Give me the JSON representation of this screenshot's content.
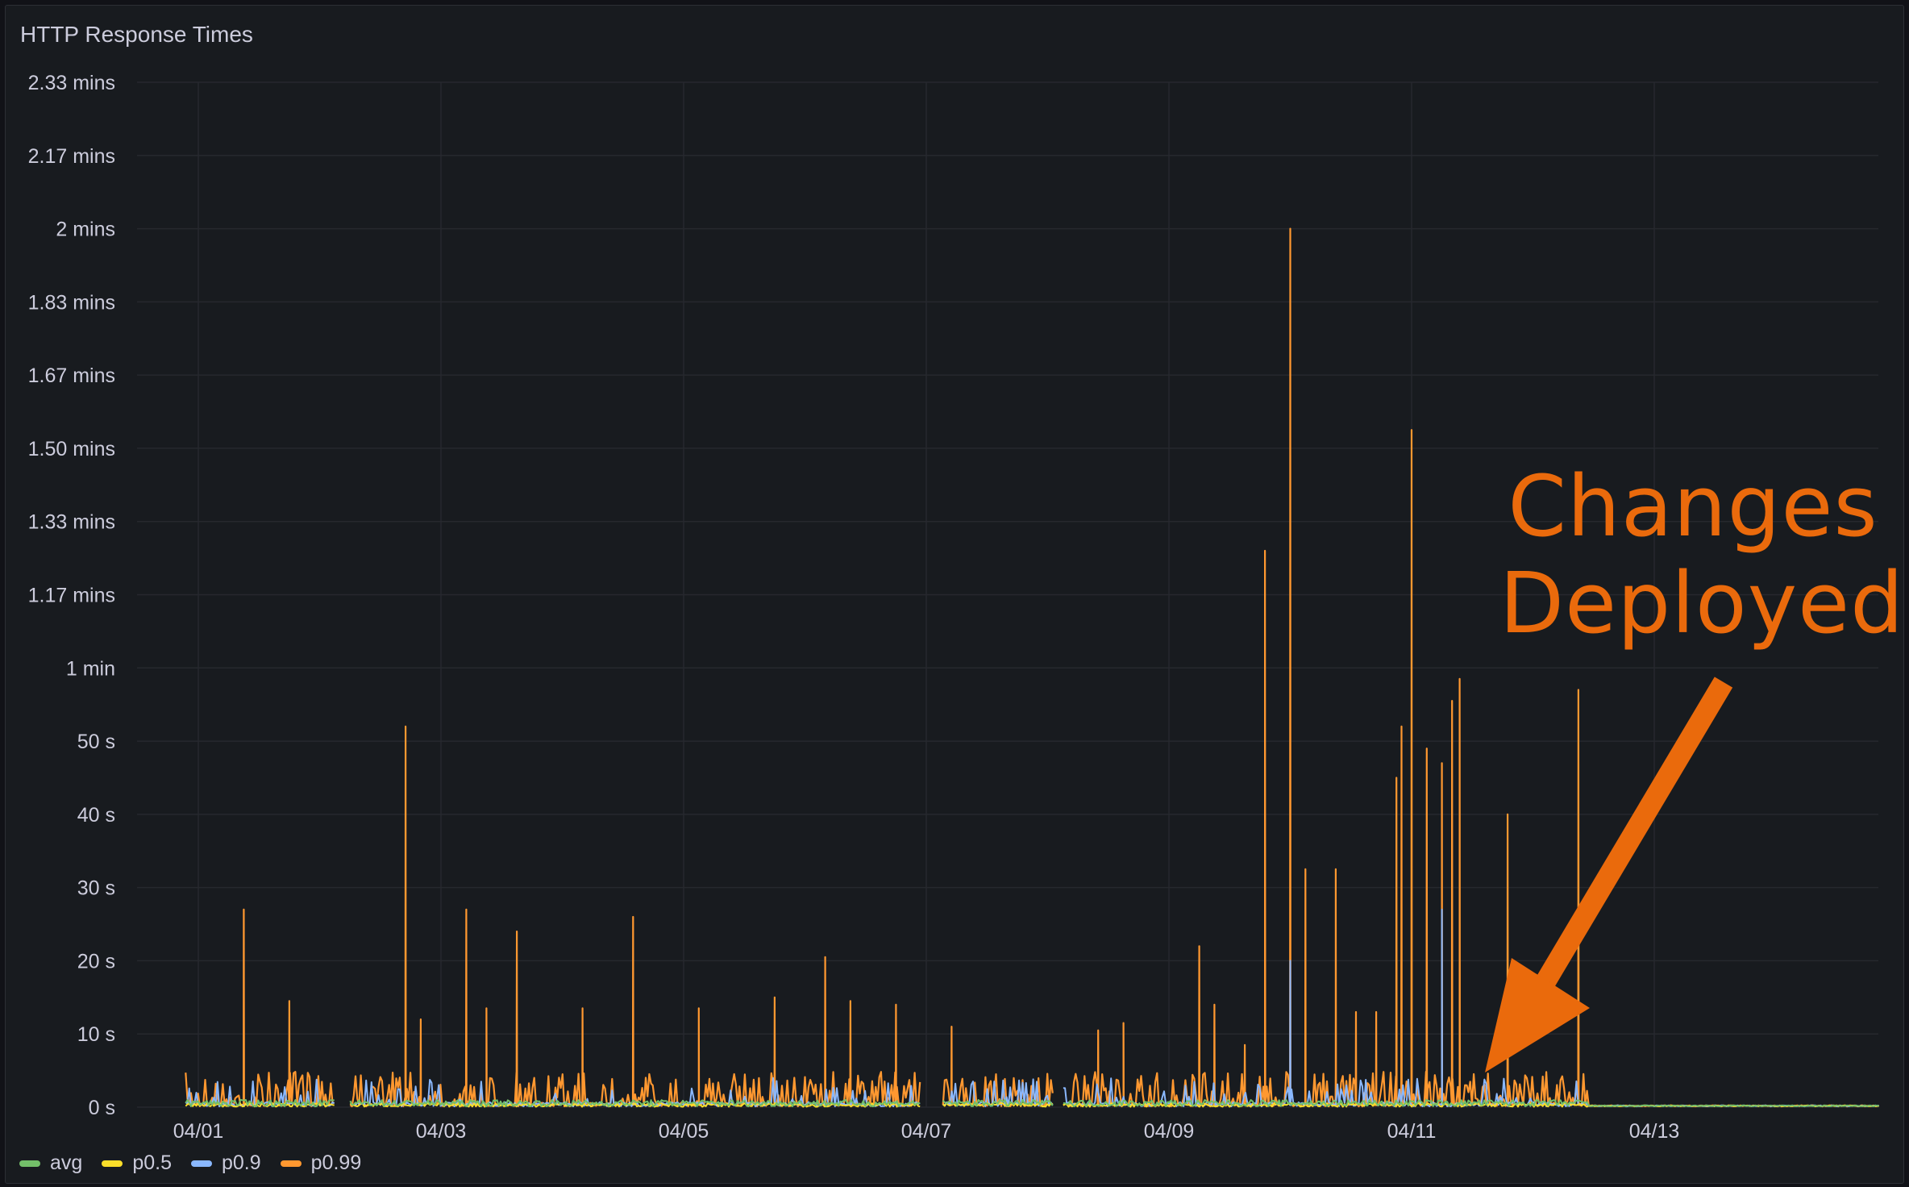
{
  "panel": {
    "title": "HTTP Response Times"
  },
  "annotation": {
    "line1": "Changes",
    "line2": "Deployed",
    "color": "#ea6a0c"
  },
  "legend": [
    {
      "label": "avg",
      "color": "#73bf69"
    },
    {
      "label": "p0.5",
      "color": "#fade2a"
    },
    {
      "label": "p0.9",
      "color": "#8ab8ff"
    },
    {
      "label": "p0.99",
      "color": "#ff9830"
    }
  ],
  "chart_data": {
    "type": "line",
    "title": "HTTP Response Times",
    "xlabel": "",
    "ylabel": "",
    "x_range": [
      "03/31 21:00",
      "04/14 21:00"
    ],
    "x_ticks": [
      "04/01",
      "04/03",
      "04/05",
      "04/07",
      "04/09",
      "04/11",
      "04/13"
    ],
    "ylim": [
      0,
      140
    ],
    "y_ticks": [
      {
        "value": 0,
        "label": "0 s"
      },
      {
        "value": 10,
        "label": "10 s"
      },
      {
        "value": 20,
        "label": "20 s"
      },
      {
        "value": 30,
        "label": "30 s"
      },
      {
        "value": 40,
        "label": "40 s"
      },
      {
        "value": 50,
        "label": "50 s"
      },
      {
        "value": 60,
        "label": "1 min"
      },
      {
        "value": 70,
        "label": "1.17 mins"
      },
      {
        "value": 80,
        "label": "1.33 mins"
      },
      {
        "value": 90,
        "label": "1.50 mins"
      },
      {
        "value": 100,
        "label": "1.67 mins"
      },
      {
        "value": 110,
        "label": "1.83 mins"
      },
      {
        "value": 120,
        "label": "2 mins"
      },
      {
        "value": 130,
        "label": "2.17 mins"
      },
      {
        "value": 140,
        "label": "2.33 mins"
      }
    ],
    "grid": true,
    "legend_position": "bottom-left",
    "series": [
      {
        "name": "p0.99",
        "color": "#ff9830",
        "spikes": [
          [
            "04/01 09:00",
            27
          ],
          [
            "04/01 18:00",
            14.5
          ],
          [
            "04/02 17:00",
            52
          ],
          [
            "04/02 20:00",
            12
          ],
          [
            "04/03 05:00",
            27
          ],
          [
            "04/03 09:00",
            13.5
          ],
          [
            "04/03 15:00",
            24
          ],
          [
            "04/04 04:00",
            13.5
          ],
          [
            "04/04 14:00",
            26
          ],
          [
            "04/05 03:00",
            13.5
          ],
          [
            "04/05 18:00",
            15
          ],
          [
            "04/06 04:00",
            20.5
          ],
          [
            "04/06 09:00",
            14.5
          ],
          [
            "04/06 18:00",
            14
          ],
          [
            "04/07 05:00",
            11
          ],
          [
            "04/08 10:00",
            10.5
          ],
          [
            "04/08 15:00",
            11.5
          ],
          [
            "04/09 06:00",
            22
          ],
          [
            "04/09 09:00",
            14
          ],
          [
            "04/09 15:00",
            8.5
          ],
          [
            "04/09 19:00",
            76
          ],
          [
            "04/10 00:00",
            120
          ],
          [
            "04/10 03:00",
            32.5
          ],
          [
            "04/10 09:00",
            32.5
          ],
          [
            "04/10 13:00",
            13
          ],
          [
            "04/10 17:00",
            13
          ],
          [
            "04/10 21:00",
            45
          ],
          [
            "04/10 22:00",
            52
          ],
          [
            "04/11 00:00",
            92.5
          ],
          [
            "04/11 03:00",
            49
          ],
          [
            "04/11 06:00",
            47
          ],
          [
            "04/11 08:00",
            55.5
          ],
          [
            "04/11 09:30",
            58.5
          ],
          [
            "04/11 19:00",
            40
          ],
          [
            "04/12 09:00",
            57
          ]
        ]
      },
      {
        "name": "p0.9",
        "color": "#8ab8ff",
        "note_peaks": [
          [
            "04/10 00:00",
            20
          ],
          [
            "04/11 06:00",
            27
          ]
        ]
      },
      {
        "name": "p0.5",
        "color": "#fade2a"
      },
      {
        "name": "avg",
        "color": "#73bf69"
      }
    ]
  }
}
